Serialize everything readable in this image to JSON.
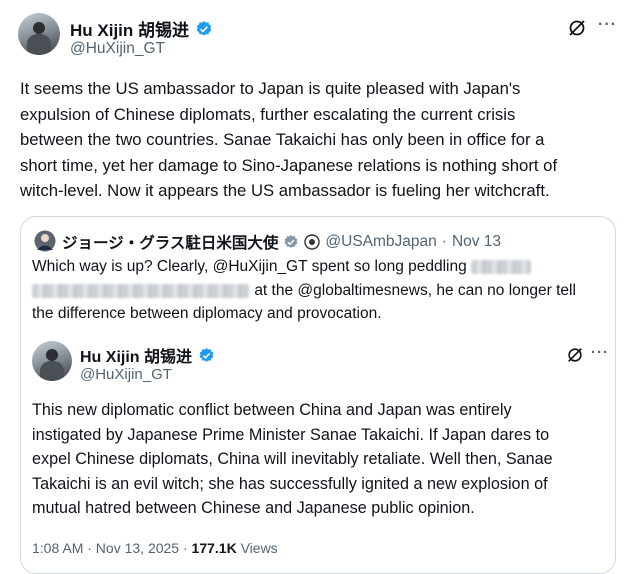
{
  "main_tweet": {
    "author_name": "Hu Xijin 胡锡进",
    "handle": "@HuXijin_GT",
    "text": "It seems the US ambassador to Japan is quite pleased with Japan's\nexpulsion of Chinese diplomats, further escalating the current crisis\nbetween the two countries. Sanae Takaichi has only been in office for a\nshort time, yet her damage to Sino-Japanese relations is nothing short of\nwitch-level. Now it appears the US ambassador is fueling her witchcraft."
  },
  "quoted_tweet": {
    "author_name": "ジョージ・グラス駐日米国大使",
    "handle": "@USAmbJapan",
    "separator": "·",
    "date": "Nov 13",
    "line1": "Which way is up? Clearly, @HuXijin_GT spent so long peddling",
    "line2": "at the @globaltimesnews, he can no longer tell",
    "line3": "the difference between diplomacy and provocation."
  },
  "nested_tweet": {
    "author_name": "Hu Xijin 胡锡进",
    "handle": "@HuXijin_GT",
    "text": "This new diplomatic conflict between China and Japan was entirely\ninstigated by Japanese Prime Minister Sanae Takaichi. If Japan dares to\nexpel Chinese diplomats, China will inevitably retaliate. Well then, Sanae\nTakaichi is an evil witch; she has successfully ignited a new explosion of\nmutual hatred between Chinese and Japanese public opinion.",
    "timestamp": "1:08 AM · Nov 13, 2025",
    "separator": "·",
    "views_count": "177.1K",
    "views_label": "Views"
  },
  "icons": {
    "grok": "grok-icon",
    "more": "more-icon",
    "verified": "verified-badge-icon",
    "gov_badge": "government-badge-icon",
    "flag": "us-flag-icon"
  },
  "colors": {
    "verified_blue": "#1d9bf0",
    "text": "#0f1419",
    "secondary": "#536471",
    "border": "#cfd9de"
  }
}
